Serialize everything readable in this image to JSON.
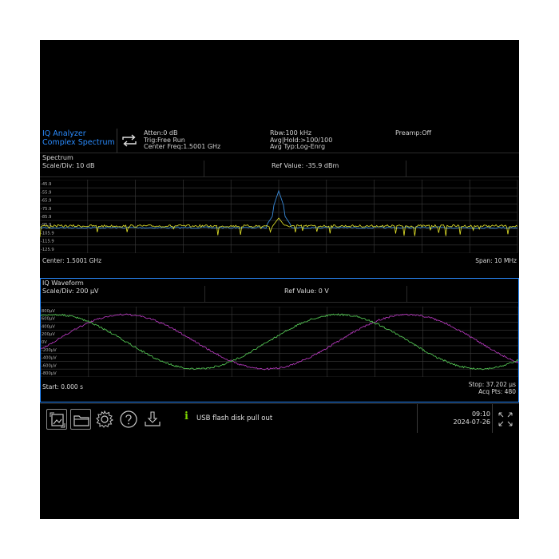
{
  "header": {
    "mode_line1": "IQ Analyzer",
    "mode_line2": "Complex Spectrum",
    "col1": [
      "Atten:0 dB",
      "Trig:Free Run",
      "Center Freq:1.5001 GHz"
    ],
    "col2": [
      "Rbw:100 kHz",
      "Avg|Hold:>100/100",
      "Avg Typ:Log-Enrg"
    ],
    "col3": [
      "Preamp:Off"
    ]
  },
  "spectrum": {
    "title": "Spectrum",
    "scale": "Scale/Div: 10 dB",
    "ref": "Ref Value: -35.9 dBm",
    "y_ticks": [
      "-45.9",
      "-55.9",
      "-65.9",
      "-75.9",
      "-85.9",
      "-95.9",
      "-105.9",
      "-115.9",
      "-125.9"
    ],
    "center": "Center: 1.5001 GHz",
    "span": "Span: 10 MHz"
  },
  "iq": {
    "title": "IQ Waveform",
    "scale": "Scale/Div: 200 µV",
    "ref": "Ref Value: 0 V",
    "y_ticks": [
      "800µV",
      "600µV",
      "400µV",
      "200µV",
      "0V",
      "-200µV",
      "-400µV",
      "-600µV",
      "-800µV"
    ],
    "start": "Start: 0.000 s",
    "stop": "Stop: 37.202 µs",
    "acq": "Acq Pts: 480"
  },
  "status": {
    "message": "USB flash disk pull out",
    "time": "09:10",
    "date": "2024-07-26"
  },
  "colors": {
    "accent": "#2a8cff",
    "trace_yellow": "#e6e62a",
    "trace_blue": "#3a8ad8",
    "trace_green": "#5ad45a",
    "trace_magenta": "#c03cc8",
    "info": "#7cd400"
  },
  "icons": [
    "image-icon",
    "folder-icon",
    "gear-icon",
    "help-icon",
    "download-icon",
    "info-icon",
    "repeat-icon",
    "fullscreen-icon"
  ]
}
